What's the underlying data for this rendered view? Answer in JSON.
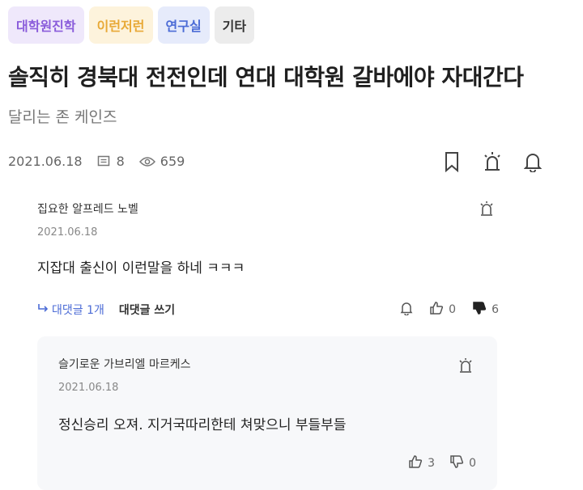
{
  "tags": [
    "대학원진학",
    "이런저런",
    "연구실",
    "기타"
  ],
  "post": {
    "title": "솔직히 경북대 전전인데 연대 대학원 갈바에야 자대간다",
    "author": "달리는 존 케인즈",
    "date": "2021.06.18",
    "comment_count": "8",
    "view_count": "659"
  },
  "comment": {
    "author": "집요한 알프레드 노벨",
    "date": "2021.06.18",
    "body": "지잡대 출신이 이런말을 하네 ㅋㅋㅋ",
    "reply_count_label": "대댓글 1개",
    "write_reply_label": "대댓글 쓰기",
    "likes": "0",
    "dislikes": "6"
  },
  "reply": {
    "author": "슬기로운 가브리엘 마르케스",
    "date": "2021.06.18",
    "body": "정신승리 오져. 지거국따리한테 쳐맞으니 부들부들",
    "likes": "3",
    "dislikes": "0"
  }
}
